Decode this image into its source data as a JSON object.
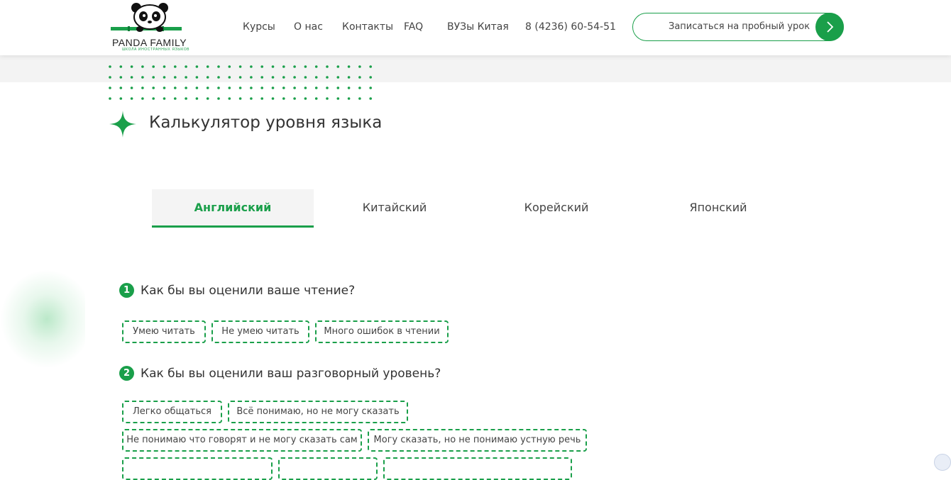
{
  "header": {
    "logo_text": "PANDA FAMILY",
    "logo_subtext": "ШКОЛА ИНОСТРАННЫХ ЯЗЫКОВ",
    "nav": {
      "courses": "Курсы",
      "about": "О нас",
      "contacts": "Контакты",
      "faq": "FAQ",
      "universities": "ВУЗы Китая",
      "phone": "8 (4236) 60-54-51"
    },
    "cta_label": "Записаться на пробный урок"
  },
  "main": {
    "title": "Калькулятор уровня языка",
    "tabs": [
      {
        "label": "Английский",
        "active": true
      },
      {
        "label": "Китайский",
        "active": false
      },
      {
        "label": "Корейский",
        "active": false
      },
      {
        "label": "Японский",
        "active": false
      }
    ],
    "questions": [
      {
        "number": "1",
        "text": "Как бы вы оценили ваше чтение?",
        "options": [
          "Умею читать",
          "Не умею читать",
          "Много ошибок в чтении"
        ]
      },
      {
        "number": "2",
        "text": "Как бы вы оценили ваш разговорный уровень?",
        "options": [
          "Легко общаться",
          "Всё понимаю, но не могу сказать",
          "Не понимаю что говорят и не могу сказать сам",
          "Могу сказать, но не понимаю устную речь"
        ]
      }
    ]
  },
  "colors": {
    "accent": "#1a9f4a"
  }
}
